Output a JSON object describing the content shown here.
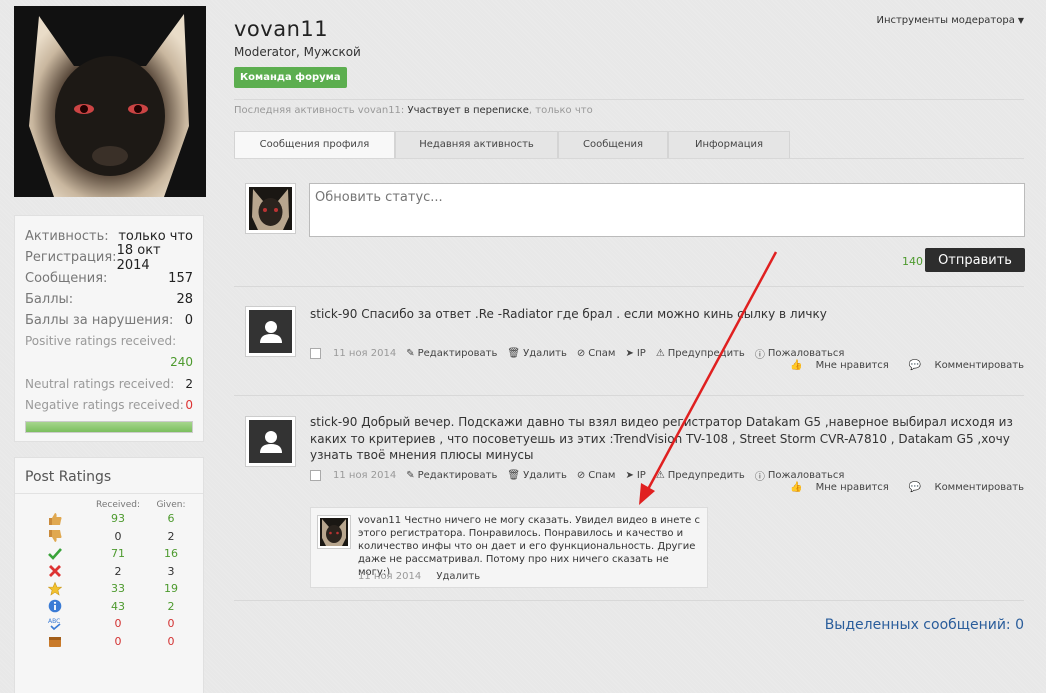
{
  "profile": {
    "username": "vovan11",
    "subtitle": "Moderator, Мужской",
    "badge": "Команда форума",
    "mod_tools": "Инструменты модератора",
    "last_activity_prefix": "Последняя активность vovan11:",
    "last_activity_action": "Участвует в переписке",
    "last_activity_time": ", только что"
  },
  "tabs": [
    {
      "label": "Сообщения профиля"
    },
    {
      "label": "Недавняя активность"
    },
    {
      "label": "Сообщения"
    },
    {
      "label": "Информация"
    }
  ],
  "stats": {
    "activity_label": "Активность:",
    "activity_value": "только что",
    "registration_label": "Регистрация:",
    "registration_value": "18 окт 2014",
    "messages_label": "Сообщения:",
    "messages_value": "157",
    "points_label": "Баллы:",
    "points_value": "28",
    "violations_label": "Баллы за нарушения:",
    "violations_value": "0",
    "positive_label": "Positive ratings received:",
    "positive_value": "240",
    "neutral_label": "Neutral ratings received:",
    "neutral_value": "2",
    "negative_label": "Negative ratings received:",
    "negative_value": "0",
    "rating_bar_fraction": 1.0
  },
  "post_ratings": {
    "title": "Post Ratings",
    "received_header": "Received:",
    "given_header": "Given:",
    "rows": [
      {
        "icon": "thumbs-up-icon",
        "received": "93",
        "given": "6",
        "received_color": "#4d9a2e",
        "given_color": "#4d9a2e"
      },
      {
        "icon": "thumbs-down-icon",
        "received": "0",
        "given": "2",
        "received_color": "#333333",
        "given_color": "#333333"
      },
      {
        "icon": "checkmark-icon",
        "received": "71",
        "given": "16",
        "received_color": "#4d9a2e",
        "given_color": "#4d9a2e"
      },
      {
        "icon": "cross-icon",
        "received": "2",
        "given": "3",
        "received_color": "#333333",
        "given_color": "#333333"
      },
      {
        "icon": "star-icon",
        "received": "33",
        "given": "19",
        "received_color": "#4d9a2e",
        "given_color": "#4d9a2e"
      },
      {
        "icon": "info-icon",
        "received": "43",
        "given": "2",
        "received_color": "#4d9a2e",
        "given_color": "#4d9a2e"
      },
      {
        "icon": "spellcheck-icon",
        "received": "0",
        "given": "0",
        "received_color": "#d33333",
        "given_color": "#d33333"
      },
      {
        "icon": "box-icon",
        "received": "0",
        "given": "0",
        "received_color": "#d33333",
        "given_color": "#d33333"
      }
    ]
  },
  "status": {
    "placeholder": "Обновить статус...",
    "counter": "140",
    "send_label": "Отправить"
  },
  "messages": [
    {
      "author": "stick-90",
      "text": " Спасибо за ответ .Re -Radiator где брал . если можно кинь сылку в личку",
      "date": "11 ноя 2014"
    },
    {
      "author": "stick-90",
      "text": " Добрый вечер. Подскажи давно ты взял видео регистратор Datakam G5 ,наверное выбирал исходя из каких то критериев , что посоветуешь из этих :TrendVision TV-108 , Street Storm CVR-A7810 , Datakam G5 ,хочу узнать твоё мнения плюсы минусы",
      "date": "11 ноя 2014"
    }
  ],
  "actions": {
    "edit": "Редактировать",
    "delete": "Удалить",
    "spam": "Спам",
    "ip": "IP",
    "warn": "Предупредить",
    "report": "Пожаловаться",
    "like": "Мне нравится",
    "comment": "Комментировать"
  },
  "comment": {
    "author": "vovan11",
    "text": " Честно ничего не могу сказать. Увидел видео в инете с этого регистратора. Понравилось. Понравилось и качество и количество инфы что он дает и его функциональность. Другие даже не рассматривал. Потому про них ничего сказать не могу:)",
    "date": "11 ноя 2014",
    "delete": "Удалить"
  },
  "selected_messages": "Выделенных сообщений: 0",
  "colors": {
    "accent_green": "#5cae4f",
    "link_blue": "#2a5d9b",
    "arrow_red": "#e02020"
  }
}
